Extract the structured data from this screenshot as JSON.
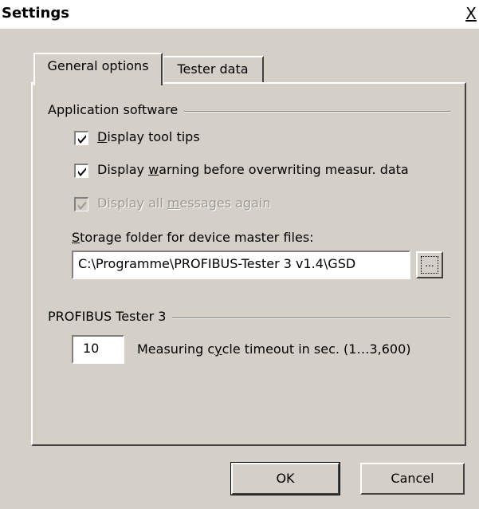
{
  "window": {
    "title": "Settings",
    "close_glyph": "X"
  },
  "tabs": [
    {
      "label": "General options",
      "active": true
    },
    {
      "label": "Tester data",
      "active": false
    }
  ],
  "app_software": {
    "group_label": "Application software",
    "tooltips": {
      "pre": "",
      "key": "D",
      "post": "isplay tool tips",
      "checked": true,
      "enabled": true
    },
    "warning": {
      "pre": "Display ",
      "key": "w",
      "post": "arning before overwriting measur. data",
      "checked": true,
      "enabled": true
    },
    "messages": {
      "pre": "Display all ",
      "key": "m",
      "post": "essages again",
      "checked": true,
      "enabled": false
    },
    "storage_label": {
      "pre": "",
      "key": "S",
      "post": "torage folder for device master files:"
    },
    "storage_path": "C:\\Programme\\PROFIBUS-Tester 3 v1.4\\GSD",
    "browse_label": "..."
  },
  "tester": {
    "group_label": "PROFIBUS Tester 3",
    "timeout_value": "10",
    "timeout_label": {
      "pre": "Measuring c",
      "key": "y",
      "post": "cle timeout in sec. (1…3,600)"
    }
  },
  "buttons": {
    "ok": "OK",
    "cancel": "Cancel"
  },
  "colors": {
    "face": "#d4d0c8",
    "shadow": "#808080",
    "highlight": "#ffffff"
  }
}
